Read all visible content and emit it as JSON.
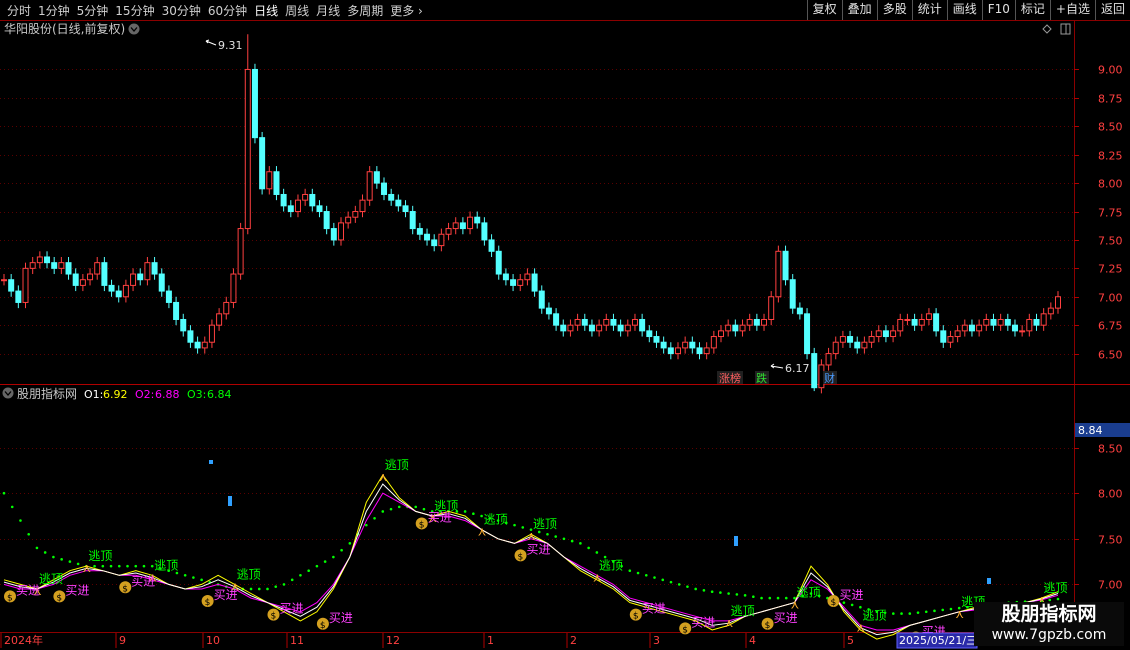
{
  "toolbar": {
    "periods": [
      "分时",
      "1分钟",
      "5分钟",
      "15分钟",
      "30分钟",
      "60分钟",
      "日线",
      "周线",
      "月线",
      "多周期",
      "更多"
    ],
    "active_period": "日线",
    "right_buttons": [
      "复权",
      "叠加",
      "多股",
      "统计",
      "画线",
      "F10",
      "标记",
      "+自选",
      "返回"
    ]
  },
  "main_panel": {
    "title": "华阳股份(日线,前复权)",
    "high_label": "9.31",
    "low_label": "6.17",
    "y_ticks": [
      "9.00",
      "8.75",
      "8.50",
      "8.25",
      "8.00",
      "7.75",
      "7.50",
      "7.25",
      "7.00",
      "6.75",
      "6.50"
    ],
    "badges": [
      {
        "text": "涨榜",
        "color": "#ff6060"
      },
      {
        "text": "跌",
        "color": "#30e030"
      },
      {
        "text": "财",
        "color": "#4a9cff"
      }
    ]
  },
  "indicator_panel": {
    "title": "股朋指标网",
    "o1_label": "O1:",
    "o1_value": "6.92",
    "o2_label": "O2:",
    "o2_value": "6.88",
    "o3_label": "O3:",
    "o3_value": "6.84",
    "current_value": "8.84",
    "y_ticks": [
      "8.50",
      "8.00",
      "7.50",
      "7.00"
    ],
    "signal_sell": "逃顶",
    "signal_buy": "买进"
  },
  "date_axis": {
    "labels": [
      "2024年",
      "9",
      "10",
      "11",
      "12",
      "1",
      "2",
      "3",
      "4",
      "5"
    ],
    "cursor_date": "2025/05/21/三"
  },
  "watermark": {
    "line1": "股朋指标网",
    "line2": "www.7gpzb.com"
  },
  "colors": {
    "up": "#ff4040",
    "down": "#54ffff",
    "o1": "#ffff00",
    "o2": "#ff00ff",
    "o3": "#00ff00",
    "grid": "#8b0000"
  },
  "chart_data": {
    "type": "candlestick",
    "title": "华阳股份(日线,前复权)",
    "ylim": [
      6.25,
      9.4
    ],
    "annotations": {
      "high": 9.31,
      "low": 6.17
    },
    "close_series": [
      7.15,
      7.05,
      6.95,
      7.25,
      7.3,
      7.35,
      7.3,
      7.25,
      7.3,
      7.2,
      7.1,
      7.15,
      7.2,
      7.3,
      7.1,
      7.05,
      7.0,
      7.1,
      7.2,
      7.15,
      7.3,
      7.2,
      7.05,
      6.95,
      6.8,
      6.7,
      6.6,
      6.55,
      6.6,
      6.75,
      6.85,
      6.95,
      7.2,
      7.6,
      9.0,
      8.4,
      7.95,
      8.1,
      7.9,
      7.8,
      7.75,
      7.85,
      7.9,
      7.8,
      7.75,
      7.6,
      7.5,
      7.65,
      7.7,
      7.75,
      7.85,
      8.1,
      8.0,
      7.9,
      7.85,
      7.8,
      7.75,
      7.6,
      7.55,
      7.5,
      7.45,
      7.55,
      7.6,
      7.65,
      7.6,
      7.7,
      7.65,
      7.5,
      7.4,
      7.2,
      7.15,
      7.1,
      7.15,
      7.2,
      7.05,
      6.9,
      6.85,
      6.75,
      6.7,
      6.75,
      6.8,
      6.75,
      6.7,
      6.75,
      6.8,
      6.75,
      6.7,
      6.75,
      6.8,
      6.7,
      6.65,
      6.6,
      6.55,
      6.5,
      6.55,
      6.6,
      6.55,
      6.5,
      6.55,
      6.65,
      6.7,
      6.75,
      6.7,
      6.75,
      6.8,
      6.75,
      6.8,
      7.0,
      7.4,
      7.15,
      6.9,
      6.85,
      6.5,
      6.2,
      6.4,
      6.5,
      6.6,
      6.65,
      6.6,
      6.55,
      6.6,
      6.65,
      6.7,
      6.65,
      6.7,
      6.8,
      6.8,
      6.75,
      6.8,
      6.85,
      6.7,
      6.6,
      6.65,
      6.7,
      6.75,
      6.7,
      6.75,
      6.8,
      6.75,
      6.8,
      6.75,
      6.7,
      6.7,
      6.8,
      6.75,
      6.85,
      6.9,
      7.0
    ],
    "indicator": {
      "o1": [
        7.05,
        7.0,
        6.95,
        7.05,
        7.15,
        7.2,
        7.15,
        7.1,
        7.15,
        7.1,
        7.0,
        6.95,
        7.0,
        7.1,
        7.0,
        6.9,
        6.8,
        6.7,
        6.6,
        6.7,
        6.95,
        7.3,
        7.9,
        8.2,
        7.95,
        7.8,
        7.75,
        7.8,
        7.75,
        7.6,
        7.5,
        7.45,
        7.55,
        7.45,
        7.3,
        7.15,
        7.05,
        6.95,
        6.8,
        6.75,
        6.7,
        6.65,
        6.6,
        6.5,
        6.55,
        6.65,
        6.7,
        6.75,
        6.8,
        7.2,
        7.0,
        6.7,
        6.5,
        6.4,
        6.45,
        6.55,
        6.6,
        6.65,
        6.7,
        6.75,
        6.75,
        6.8,
        6.8,
        6.85,
        6.92
      ],
      "o2": [
        7.0,
        6.95,
        6.95,
        7.0,
        7.1,
        7.15,
        7.15,
        7.1,
        7.1,
        7.05,
        7.0,
        6.95,
        6.95,
        7.0,
        6.95,
        6.85,
        6.8,
        6.75,
        6.7,
        6.8,
        7.0,
        7.3,
        7.7,
        8.0,
        7.9,
        7.8,
        7.75,
        7.75,
        7.7,
        7.6,
        7.5,
        7.45,
        7.5,
        7.45,
        7.3,
        7.2,
        7.1,
        7.0,
        6.85,
        6.8,
        6.75,
        6.7,
        6.65,
        6.6,
        6.6,
        6.65,
        6.7,
        6.75,
        6.8,
        7.05,
        6.95,
        6.75,
        6.55,
        6.5,
        6.5,
        6.55,
        6.6,
        6.65,
        6.7,
        6.72,
        6.75,
        6.78,
        6.8,
        6.83,
        6.88
      ],
      "o3": [
        8.0,
        7.7,
        7.4,
        7.3,
        7.25,
        7.2,
        7.2,
        7.2,
        7.2,
        7.2,
        7.15,
        7.1,
        7.05,
        7.0,
        6.95,
        6.95,
        6.95,
        7.0,
        7.1,
        7.2,
        7.3,
        7.45,
        7.65,
        7.8,
        7.85,
        7.85,
        7.8,
        7.8,
        7.8,
        7.75,
        7.7,
        7.65,
        7.6,
        7.55,
        7.5,
        7.45,
        7.35,
        7.25,
        7.15,
        7.1,
        7.05,
        7.0,
        6.95,
        6.92,
        6.9,
        6.88,
        6.85,
        6.85,
        6.85,
        6.9,
        6.85,
        6.8,
        6.75,
        6.7,
        6.68,
        6.68,
        6.7,
        6.72,
        6.74,
        6.76,
        6.78,
        6.8,
        6.81,
        6.82,
        6.84
      ],
      "ylim": [
        6.5,
        9.0
      ]
    }
  }
}
